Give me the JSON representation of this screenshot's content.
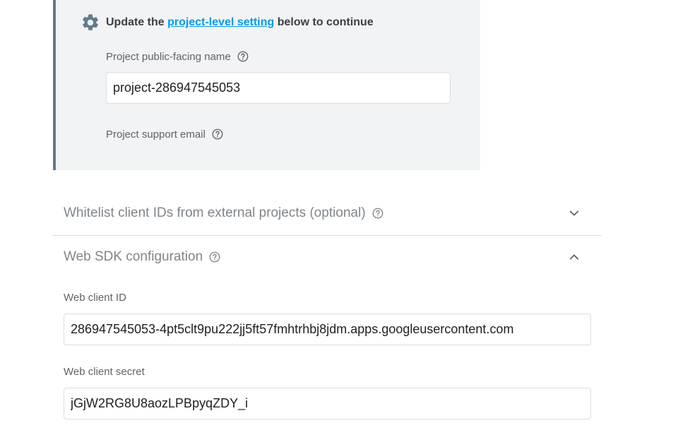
{
  "notice": {
    "title_prefix": "Update the ",
    "title_link": "project-level setting",
    "title_suffix": " below to continue",
    "public_name_label": "Project public-facing name",
    "public_name_value": "project-286947545053",
    "support_email_label": "Project support email"
  },
  "panels": {
    "whitelist_title": "Whitelist client IDs from external projects (optional)",
    "web_sdk_title": "Web SDK configuration"
  },
  "web_sdk": {
    "client_id_label": "Web client ID",
    "client_id_value": "286947545053-4pt5clt9pu222jj5ft57fmhtrhbj8jdm.apps.googleusercontent.com",
    "client_secret_label": "Web client secret",
    "client_secret_value": "jGjW2RG8U8aozLPBpyqZDY_i"
  },
  "colors": {
    "accent_link": "#039be5",
    "notice_border": "#607d8b",
    "notice_bg": "#f1f3f4"
  },
  "icons": {
    "gear": "gear-icon",
    "help": "help-circle-icon",
    "expand": "chevron-down-icon",
    "collapse": "chevron-up-icon"
  }
}
